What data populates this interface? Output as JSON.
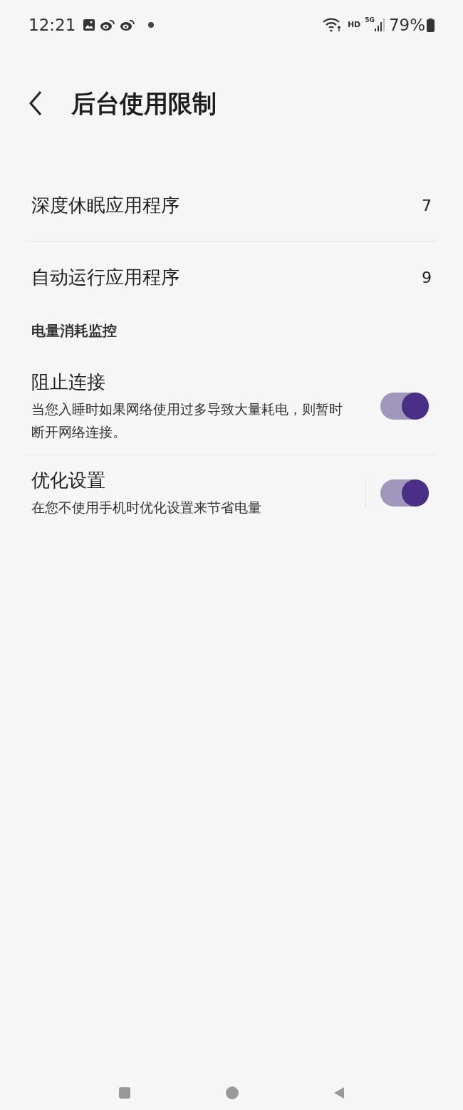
{
  "status_bar": {
    "time": "12:21",
    "network": "HD",
    "network_type": "5G",
    "battery": "79%"
  },
  "header": {
    "title": "后台使用限制"
  },
  "list_items": [
    {
      "label": "深度休眠应用程序",
      "count": "7"
    },
    {
      "label": "自动运行应用程序",
      "count": "9"
    }
  ],
  "section": {
    "title": "电量消耗监控",
    "toggles": [
      {
        "title": "阻止连接",
        "description": "当您入睡时如果网络使用过多导致大量耗电，则暂时断开网络连接。",
        "on": true,
        "divider_before_switch": false
      },
      {
        "title": "优化设置",
        "description": "在您不使用手机时优化设置来节省电量",
        "on": true,
        "divider_before_switch": true
      }
    ]
  }
}
